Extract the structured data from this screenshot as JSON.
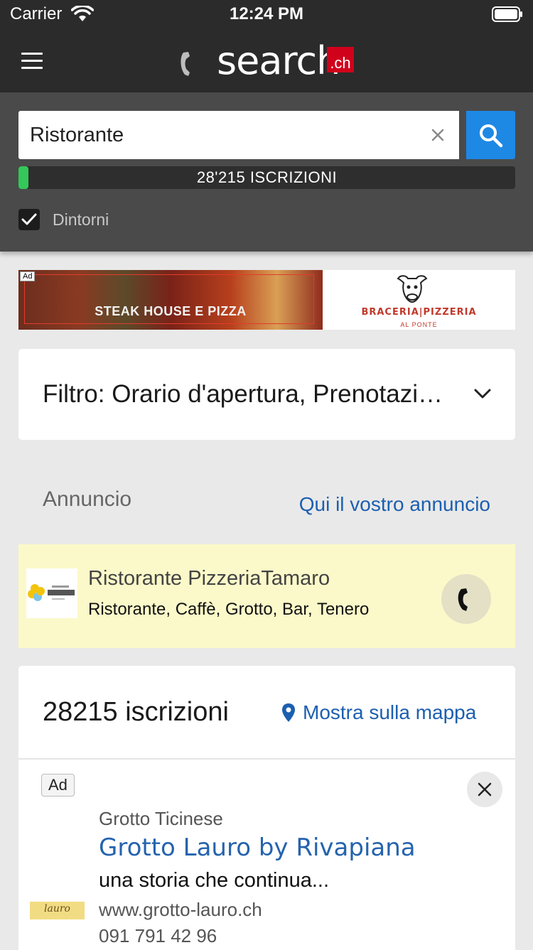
{
  "status_bar": {
    "carrier": "Carrier",
    "time": "12:24 PM"
  },
  "nav": {
    "logo_text": "search",
    "logo_suffix": ".ch",
    "brand_color": "#d0021b"
  },
  "search": {
    "query": "Ristorante",
    "progress_label": "28'215  ISCRIZIONI",
    "progress_fraction": 0.02,
    "nearby_label": "Dintorni",
    "nearby_checked": true,
    "button_color": "#1e88e5"
  },
  "banner": {
    "ad_tag": "Ad",
    "headline": "STEAK HOUSE E PIZZA",
    "brand": "BRACERIA|PIZZERIA",
    "brand_sub": "AL PONTE"
  },
  "filter": {
    "label": "Filtro: Orario d'apertura, Prenotazione online"
  },
  "ads_section": {
    "label": "Annuncio",
    "link": "Qui il vostro annuncio"
  },
  "sponsored": {
    "title": "Ristorante PizzeriaTamaro",
    "subtitle": "Ristorante, Caffè, Grotto, Bar, Tenero",
    "background": "#fbf9c9"
  },
  "results": {
    "count_label": "28215 iscrizioni",
    "map_link": "Mostra sulla mappa",
    "first_entry": {
      "badge": "Ad",
      "category": "Grotto Ticinese",
      "title": "Grotto Lauro by Rivapiana",
      "description": "una storia che continua...",
      "url": "www.grotto-lauro.ch",
      "phone": "091 791 42 96"
    }
  },
  "icons": {
    "menu": "hamburger-icon",
    "clear": "close-icon",
    "search": "search-icon",
    "check": "check-icon",
    "chevron": "chevron-down-icon",
    "phone": "phone-icon",
    "map_pin": "map-pin-icon",
    "dismiss": "close-icon"
  }
}
